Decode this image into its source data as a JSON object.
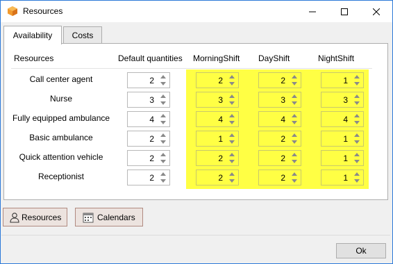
{
  "window": {
    "title": "Resources",
    "app_icon": "box-icon"
  },
  "tabs": [
    {
      "label": "Availability",
      "active": true
    },
    {
      "label": "Costs",
      "active": false
    }
  ],
  "table": {
    "headers": [
      "Resources",
      "Default quantities",
      "MorningShift",
      "DayShift",
      "NightShift"
    ],
    "highlight_color": "#ffff44",
    "rows": [
      {
        "name": "Call center agent",
        "default": "2",
        "morning": "2",
        "day": "2",
        "night": "1"
      },
      {
        "name": "Nurse",
        "default": "3",
        "morning": "3",
        "day": "3",
        "night": "3"
      },
      {
        "name": "Fully equipped ambulance",
        "default": "4",
        "morning": "4",
        "day": "4",
        "night": "4"
      },
      {
        "name": "Basic ambulance",
        "default": "2",
        "morning": "1",
        "day": "2",
        "night": "1"
      },
      {
        "name": "Quick attention vehicle",
        "default": "2",
        "morning": "2",
        "day": "2",
        "night": "1"
      },
      {
        "name": "Receptionist",
        "default": "2",
        "morning": "2",
        "day": "2",
        "night": "1"
      }
    ]
  },
  "buttons": {
    "resources": {
      "label": "Resources",
      "icon": "user-icon"
    },
    "calendars": {
      "label": "Calendars",
      "icon": "calendar-icon"
    },
    "ok": "Ok"
  }
}
